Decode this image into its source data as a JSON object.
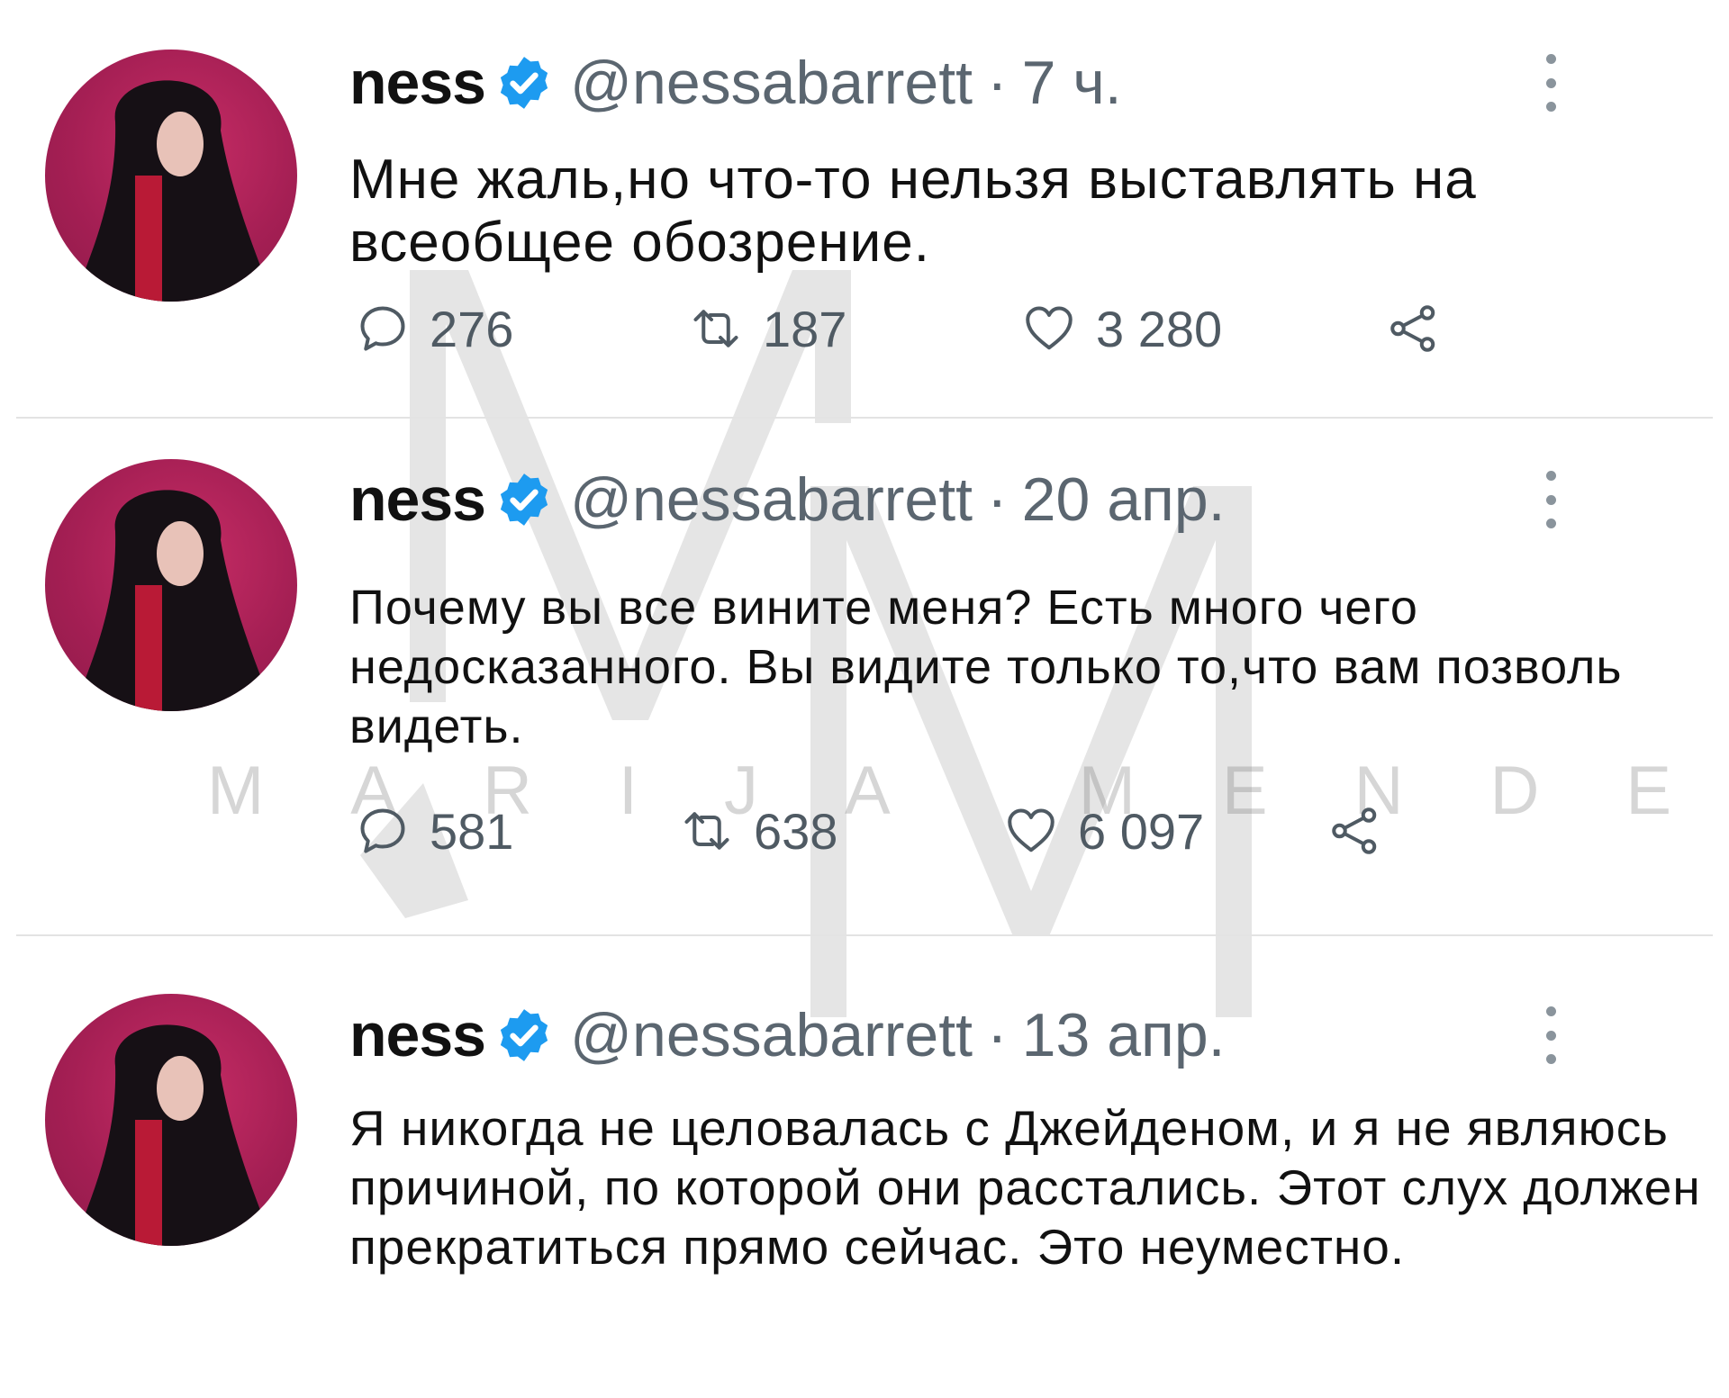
{
  "watermark": {
    "letters": "MARIJA MENDES"
  },
  "icons": {
    "reply": "reply-icon",
    "retweet": "retweet-icon",
    "like": "heart-icon",
    "share": "share-icon",
    "verified": "verified-badge-icon",
    "more": "more-vertical-icon"
  },
  "colors": {
    "avatar_bg": "#a51f54",
    "verified": "#1d9bf0",
    "meta_text": "#5b6670",
    "icon": "#4f5a63"
  },
  "tweets": [
    {
      "name": "ness",
      "handle": "@nessabarrett",
      "separator": "·",
      "time": "7 ч.",
      "text": "Мне жаль,но что-то нельзя выставлять на всеобщее обозрение.",
      "replies": "276",
      "retweets": "187",
      "likes": "3 280"
    },
    {
      "name": "ness",
      "handle": "@nessabarrett",
      "separator": "·",
      "time": "20 апр.",
      "text": "Почему вы все вините меня? Есть много чего недосказанного. Вы видите только то,что вам позволь видеть.",
      "replies": "581",
      "retweets": "638",
      "likes": "6 097"
    },
    {
      "name": "ness",
      "handle": "@nessabarrett",
      "separator": "·",
      "time": "13 апр.",
      "text": "Я никогда не целовалась с Джейденом, и я не являюсь причиной, по которой они расстались. Этот слух должен прекратиться прямо сейчас. Это неуместно."
    }
  ]
}
